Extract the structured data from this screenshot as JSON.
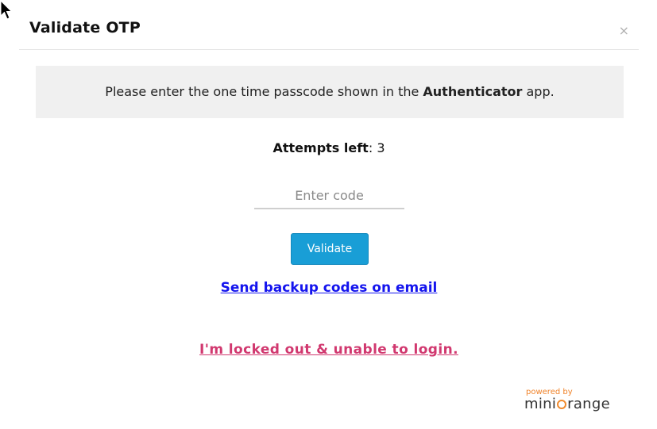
{
  "dialog": {
    "title": "Validate OTP",
    "close_glyph": "×"
  },
  "info": {
    "prefix": "Please enter the one time passcode shown in the ",
    "app_name": "Authenticator",
    "suffix": " app."
  },
  "attempts": {
    "label": "Attempts left",
    "separator": ":",
    "value": "3"
  },
  "code_input": {
    "placeholder": "Enter code",
    "value": ""
  },
  "validate_button": {
    "label": "Validate",
    "color": "#199ed6"
  },
  "links": {
    "backup": "Send backup codes on email",
    "backup_color": "#1414ee",
    "locked_out": "I'm locked out & unable to login.",
    "locked_out_color": "#d1386f"
  },
  "branding": {
    "powered_by": "powered by",
    "brand_left": "mini",
    "brand_right": "range",
    "accent_color": "#f0832a"
  },
  "icons": {
    "cursor": "mouse-pointer-icon",
    "close": "close-icon"
  }
}
